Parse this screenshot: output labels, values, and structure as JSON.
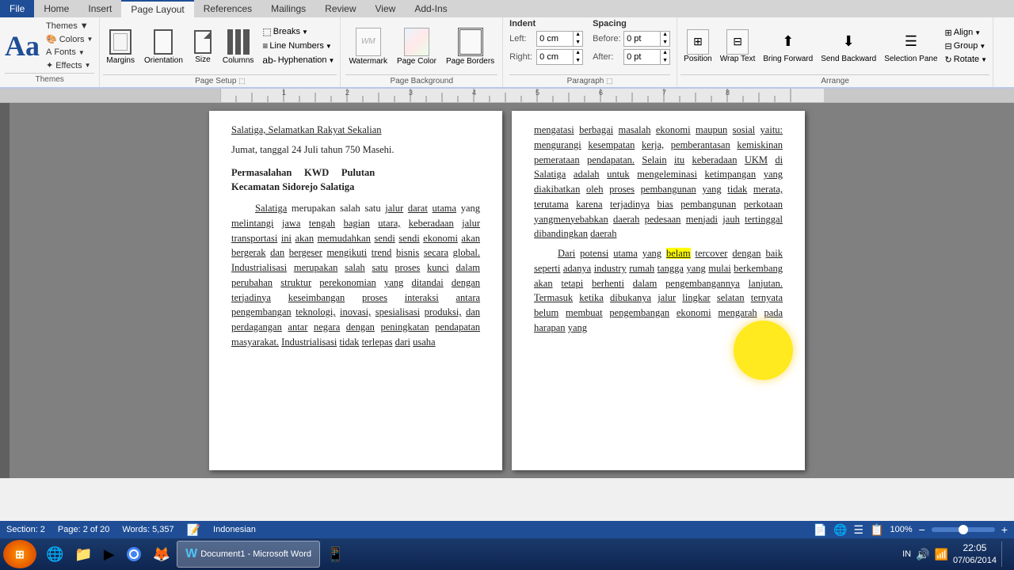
{
  "titleBar": {
    "text": "Document1 - Microsoft Word"
  },
  "ribbon": {
    "tabs": [
      {
        "label": "File",
        "active": false,
        "isFile": true
      },
      {
        "label": "Home",
        "active": false
      },
      {
        "label": "Insert",
        "active": false
      },
      {
        "label": "Page Layout",
        "active": true
      },
      {
        "label": "References",
        "active": false
      },
      {
        "label": "Mailings",
        "active": false
      },
      {
        "label": "Review",
        "active": false
      },
      {
        "label": "View",
        "active": false
      },
      {
        "label": "Add-Ins",
        "active": false
      }
    ],
    "themes": {
      "label": "Themes",
      "colors": "Colors",
      "fonts": "Fonts",
      "effects": "Effects"
    },
    "pageSetup": {
      "label": "Page Setup",
      "margins": "Margins",
      "orientation": "Orientation",
      "size": "Size",
      "columns": "Columns",
      "breaks": "Breaks",
      "lineNumbers": "Line Numbers",
      "hyphenation": "Hyphenation"
    },
    "pageBackground": {
      "label": "Page Background",
      "watermark": "Watermark",
      "pageColor": "Page Color",
      "pageBorders": "Page Borders"
    },
    "paragraph": {
      "label": "Paragraph",
      "indent": "Indent",
      "spacing": "Spacing",
      "leftLabel": "Left:",
      "rightLabel": "Right:",
      "beforeLabel": "Before:",
      "afterLabel": "After:",
      "leftValue": "0 cm",
      "rightValue": "0 cm",
      "beforeValue": "0 pt",
      "afterValue": "0 pt"
    },
    "arrange": {
      "label": "Arrange",
      "position": "Position",
      "wrapText": "Wrap Text",
      "bringForward": "Bring Forward",
      "sendBackward": "Send Backward",
      "selectionPane": "Selection Pane",
      "align": "Align",
      "group": "Group",
      "rotate": "Rotate"
    }
  },
  "document": {
    "leftPage": {
      "topText": "Salatiga, Selamatkan Rakyat Sekalian",
      "dateLine": "Jumat, tanggal 24 Juli tahun 750 Masehi.",
      "sectionTitle": "Permasalahan KWD Pulutan Kecamatan Sidorejo Salatiga",
      "para1": "Salatiga merupakan salah satu jalur darat utama yang melintangi jawa tengah bagian utara, keberadaan jalur transportasi ini akan memudahkan sendi sendi ekonomi akan bergerak dan bergeser mengikuti trend bisnis secara global. Industrialisasi merupakan salah satu proses kunci dalam perubahan struktur perekonomian yang ditandai dengan terjadinya keseimbangan proses interaksi antara pengembangan teknologi, inovasi, spesialisasi produksi, dan perdagangan antar negara dengan peningkatan pendapatan masyarakat. Industrialisasi tidak terlepas dari usaha"
    },
    "rightPage": {
      "topText": "mengatasi berbagai masalah ekonomi maupun sosial yaitu: mengurangi kesempatan kerja, pemberantasan kemiskinan pemerataan pendapatan. Selain itu keberadaan UKM di Salatiga adalah untuk mengeleminasi ketimpangan yang diakibatkan oleh proses pembangunan yang tidak merata, terutama karena terjadinya bias pembangunan perkotaan yangmenyebabkan daerah pedesaan menjadi jauh tertinggal dibandingkan daerah",
      "para2": "Dari potensi utama yang belum tercover dengan baik seperti adanya industry rumah tangga yang mulai berkembang akan tetapi berhenti dalam pengembangannya lanjutan. Termasuk ketika dibukanya jalur lingkar selatan ternyata belum membuat pengembangan ekonomi mengarah pada harapan yang"
    }
  },
  "statusBar": {
    "section": "Section: 2",
    "page": "Page: 2 of 20",
    "words": "Words: 5,357",
    "language": "Indonesian",
    "zoom": "100%"
  },
  "taskbar": {
    "startLabel": "",
    "buttons": [
      {
        "label": "IE",
        "icon": "🌐"
      },
      {
        "label": "Explorer",
        "icon": "📁"
      },
      {
        "label": "Media",
        "icon": "▶"
      },
      {
        "label": "Chrome",
        "icon": "⬤"
      },
      {
        "label": "Firefox",
        "icon": "🦊"
      },
      {
        "label": "Word",
        "icon": "W",
        "active": true
      },
      {
        "label": "App",
        "icon": "📱"
      }
    ],
    "time": "22:05",
    "date": "07/06/2014",
    "systemIcons": [
      "IN",
      "🔊",
      "🔋"
    ]
  }
}
